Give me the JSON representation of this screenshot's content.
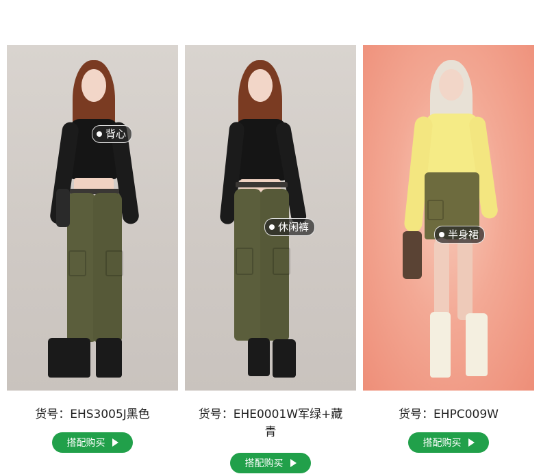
{
  "products": [
    {
      "tag": "背心",
      "code_line1": "货号：EHS3005J黑色",
      "code_line2": "",
      "buy_label": "搭配购买"
    },
    {
      "tag": "休闲裤",
      "code_line1": "货号：EHE0001W军绿+藏",
      "code_line2": "青",
      "buy_label": "搭配购买"
    },
    {
      "tag": "半身裙",
      "code_line1": "货号：EHPC009W",
      "code_line2": "",
      "buy_label": "搭配购买"
    }
  ],
  "colors": {
    "accent_green": "#21a04a",
    "photo_bg_grey": "#d9d4cf",
    "photo_bg_coral": "#f3a995"
  },
  "icons": {
    "tag_marker": "dot-icon",
    "buy_arrow": "play-triangle-icon"
  }
}
